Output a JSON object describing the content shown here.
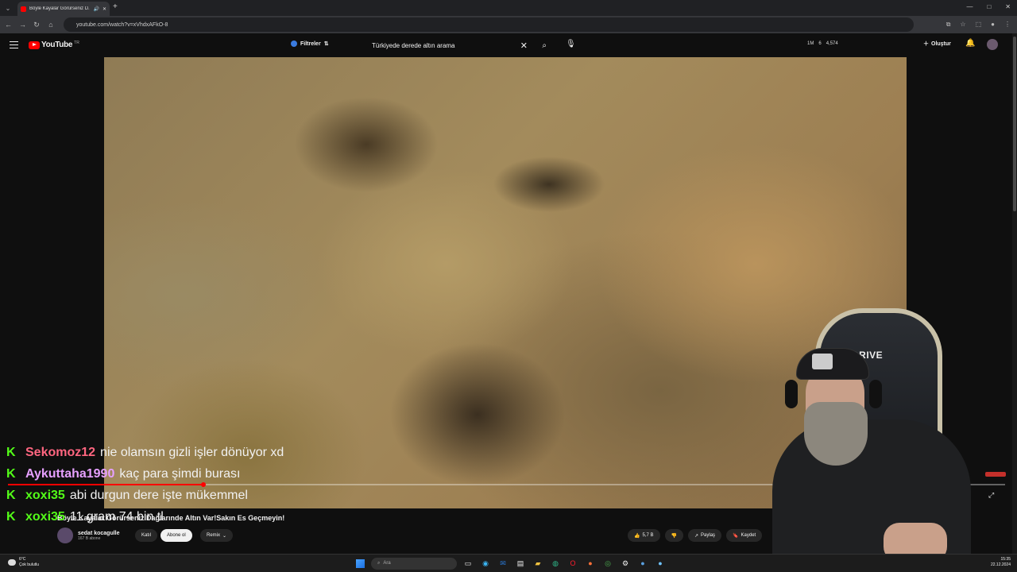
{
  "browser": {
    "tab_title": "Böyle Kayalar Görürseniz D...",
    "new_tab": "+",
    "url": "youtube.com/watch?v=xVhdxAFkO-8",
    "window_controls": [
      "—",
      "□",
      "✕"
    ]
  },
  "youtube": {
    "logo_text": "YouTube",
    "logo_region": "TR",
    "filters_label": "Filtreler",
    "search_value": "Türkiyede derede altın arama",
    "stats": {
      "views": "1M",
      "count": "6",
      "total": "4,574"
    },
    "create_label": "Oluştur"
  },
  "chat": [
    {
      "user": "Sekomoz12",
      "color": "#ff6680",
      "message": "nie olamsın gizli işler dönüyor xd"
    },
    {
      "user": "Aykuttaha1990",
      "color": "#e6a0ff",
      "message": "kaç para şimdi burası"
    },
    {
      "user": "xoxi35",
      "color": "#53fc18",
      "message": "abi durgun dere işte mükemmel"
    },
    {
      "user": "xoxi35",
      "color": "#53fc18",
      "message": "11 gram 74 bin tl"
    }
  ],
  "video": {
    "title": "Böyle Kayalar Görürseniz Dağlarınde Altın Var!Sakın Es Geçmeyin!",
    "progress_fraction": 0.196,
    "channel_name": "sedat kocagulle",
    "subscribers": "167 B abone",
    "join_label": "Katıl",
    "subscribe_label": "Abone ol",
    "remix_label": "Remix",
    "likes": "5,7 B",
    "share_label": "Paylaş",
    "save_label": "Kaydet"
  },
  "webcam": {
    "chair_brand": "DRIVE"
  },
  "taskbar": {
    "temperature": "6°C",
    "weather": "Çok bulutlu",
    "search_placeholder": "Ara",
    "time": "15:35",
    "date": "22.12.2024"
  }
}
